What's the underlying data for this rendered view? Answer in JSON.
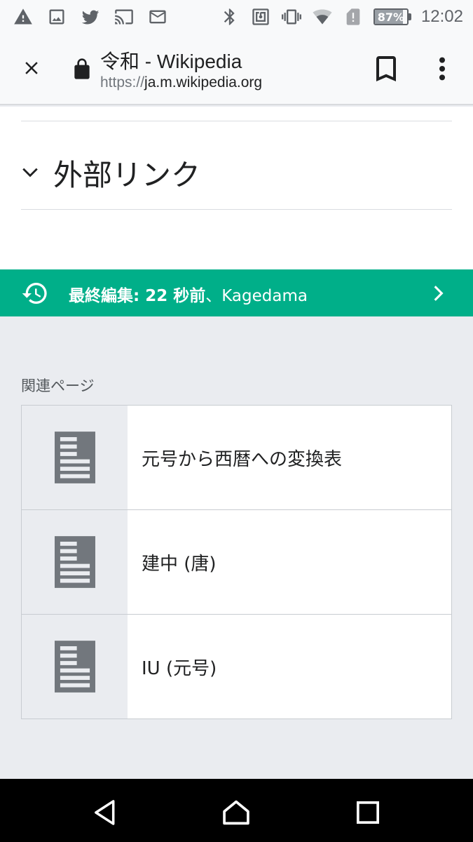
{
  "status_bar": {
    "time": "12:02",
    "battery_percent": 87,
    "battery_label": "87%",
    "icons": [
      "warning-icon",
      "image-icon",
      "twitter-icon",
      "cast-icon",
      "mail-icon",
      "bluetooth-icon",
      "nfc-icon",
      "vibrate-icon",
      "wifi-icon",
      "sim-alert-icon",
      "battery-icon"
    ]
  },
  "toolbar": {
    "title": "令和 - Wikipedia",
    "url_scheme": "https://",
    "url_host": "ja.m.wikipedia.org"
  },
  "section": {
    "heading": "外部リンク"
  },
  "last_edited": {
    "label": "最終編集: 22 秒前",
    "separator": "、",
    "user": "Kagedama"
  },
  "related": {
    "header": "関連ページ",
    "items": [
      {
        "title": "元号から西暦への変換表"
      },
      {
        "title": "建中 (唐)"
      },
      {
        "title": "IU (元号)"
      }
    ]
  },
  "colors": {
    "accent_green": "#00af89",
    "page_background": "#eaecf0",
    "toolbar_background": "#f8f9fa",
    "nav_bar": "#000000"
  }
}
